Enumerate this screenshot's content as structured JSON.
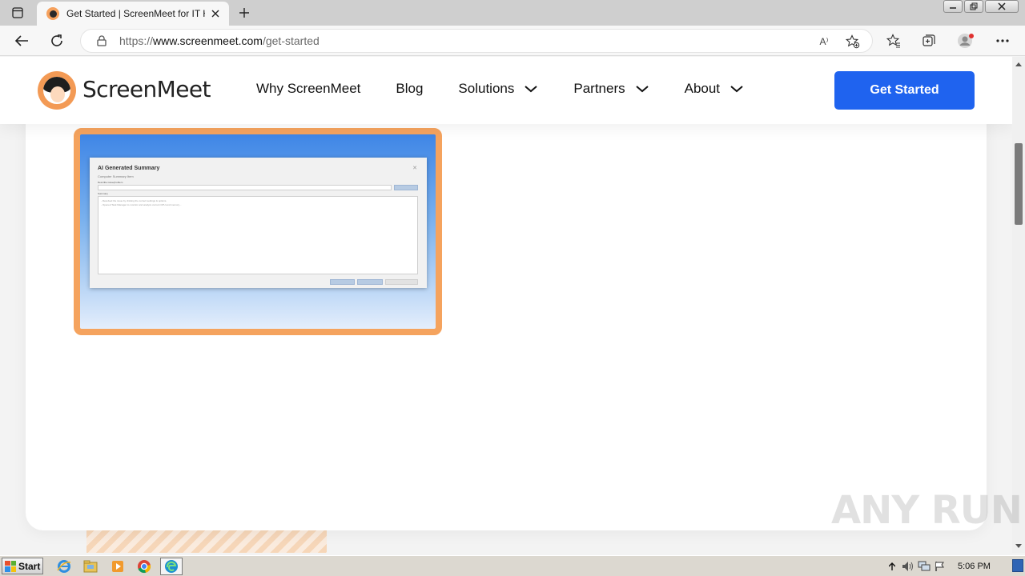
{
  "browser": {
    "tab_title": "Get Started | ScreenMeet for IT H",
    "url_prefix": "https://",
    "url_domain": "www.screenmeet.com",
    "url_path": "/get-started",
    "read_aloud_label": "A⁾"
  },
  "site": {
    "logo_text": "ScreenMeet",
    "nav": [
      {
        "label": "Why ScreenMeet",
        "has_dropdown": false
      },
      {
        "label": "Blog",
        "has_dropdown": false
      },
      {
        "label": "Solutions",
        "has_dropdown": true
      },
      {
        "label": "Partners",
        "has_dropdown": true
      },
      {
        "label": "About",
        "has_dropdown": true
      }
    ],
    "cta_label": "Get Started",
    "accent_color": "#1f63ef",
    "brand_orange": "#f5a35e"
  },
  "thumbnail": {
    "dialog_title": "AI Generated Summary",
    "dialog_subtitle": "Computer Summary Item",
    "field_label": "Describe issue/problem",
    "area_label": "Summary",
    "area_lines": [
      "- Resolved the issue by clicking the correct settings & options.",
      "- Opened Task Manager to monitor and analyze current CPU and memory..."
    ]
  },
  "watermark": "ANY RUN",
  "taskbar": {
    "start_label": "Start",
    "clock": "5:06 PM"
  }
}
